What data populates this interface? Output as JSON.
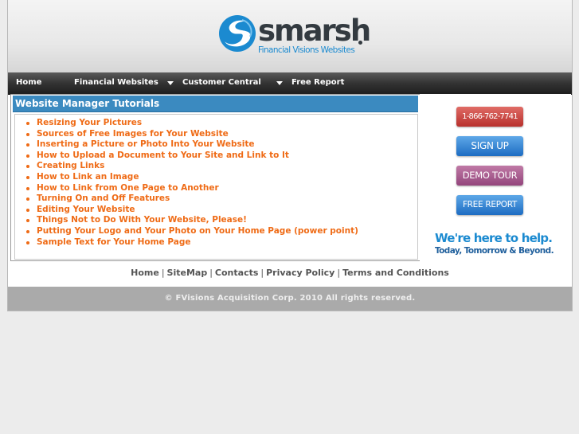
{
  "brand": {
    "name": "smarsh",
    "tagline": "Financial Visions Websites"
  },
  "nav": {
    "items": [
      {
        "label": "Home"
      },
      {
        "label": "Financial Websites"
      },
      {
        "label": "Customer Central"
      },
      {
        "label": "Free Report"
      }
    ]
  },
  "main": {
    "title": "Website Manager Tutorials",
    "tutorials": [
      "Resizing Your Pictures",
      "Sources of Free Images for Your Website",
      "Inserting a Picture or Photo Into Your Website",
      "How to Upload a Document to Your Site and Link to It",
      "Creating Links",
      "How to Link an Image",
      "How to Link from One Page to Another",
      "Turning On and Off Features",
      "Editing Your Website",
      "Things Not to Do With Your Website, Please!",
      "Putting Your Logo and Your Photo on Your Home Page (power point)",
      "Sample Text for Your Home Page"
    ]
  },
  "sidebar": {
    "phone_label": "1-866-762-7741",
    "signup_label": "SIGN UP",
    "demo_label": "DEMO TOUR",
    "report_label": "FREE REPORT",
    "help_line1": "We're here to help.",
    "help_line2": "Today, Tomorrow & Beyond."
  },
  "footer": {
    "links": [
      "Home",
      "SiteMap",
      "Contacts",
      "Privacy Policy",
      "Terms and Conditions"
    ],
    "copyright": "© FVisions Acquisition Corp. 2010 All rights reserved."
  },
  "colors": {
    "accent_blue": "#3b8ac0",
    "link_orange": "#ef6b16",
    "nav_dark": "#333333"
  }
}
